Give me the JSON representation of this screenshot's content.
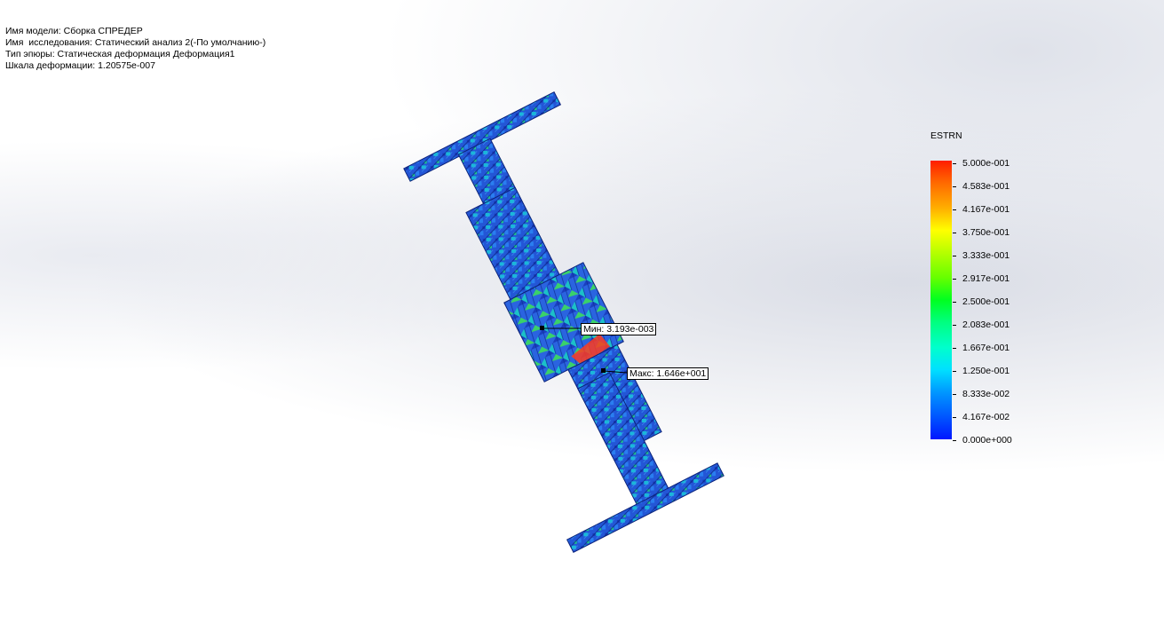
{
  "info": {
    "model_name": "Имя модели: Сборка СПРЕДЕР",
    "study_name": "Имя  исследования: Статический анализ 2(-По умолчанию-)",
    "plot_type": "Тип эпюры: Статическая деформация Деформация1",
    "deformation_scale": "Шкала деформации: 1.20575e-007"
  },
  "annotations": {
    "min": "Мин: 3.193e-003",
    "max": "Макс: 1.646e+001"
  },
  "legend": {
    "title": "ESTRN",
    "labels": [
      "5.000e-001",
      "4.583e-001",
      "4.167e-001",
      "3.750e-001",
      "3.333e-001",
      "2.917e-001",
      "2.500e-001",
      "2.083e-001",
      "1.667e-001",
      "1.250e-001",
      "8.333e-002",
      "4.167e-002",
      "0.000e+000"
    ]
  },
  "colors": {
    "low": "#0016ff",
    "high": "#ff1e00",
    "mesh_base": "#1f4fd0"
  }
}
